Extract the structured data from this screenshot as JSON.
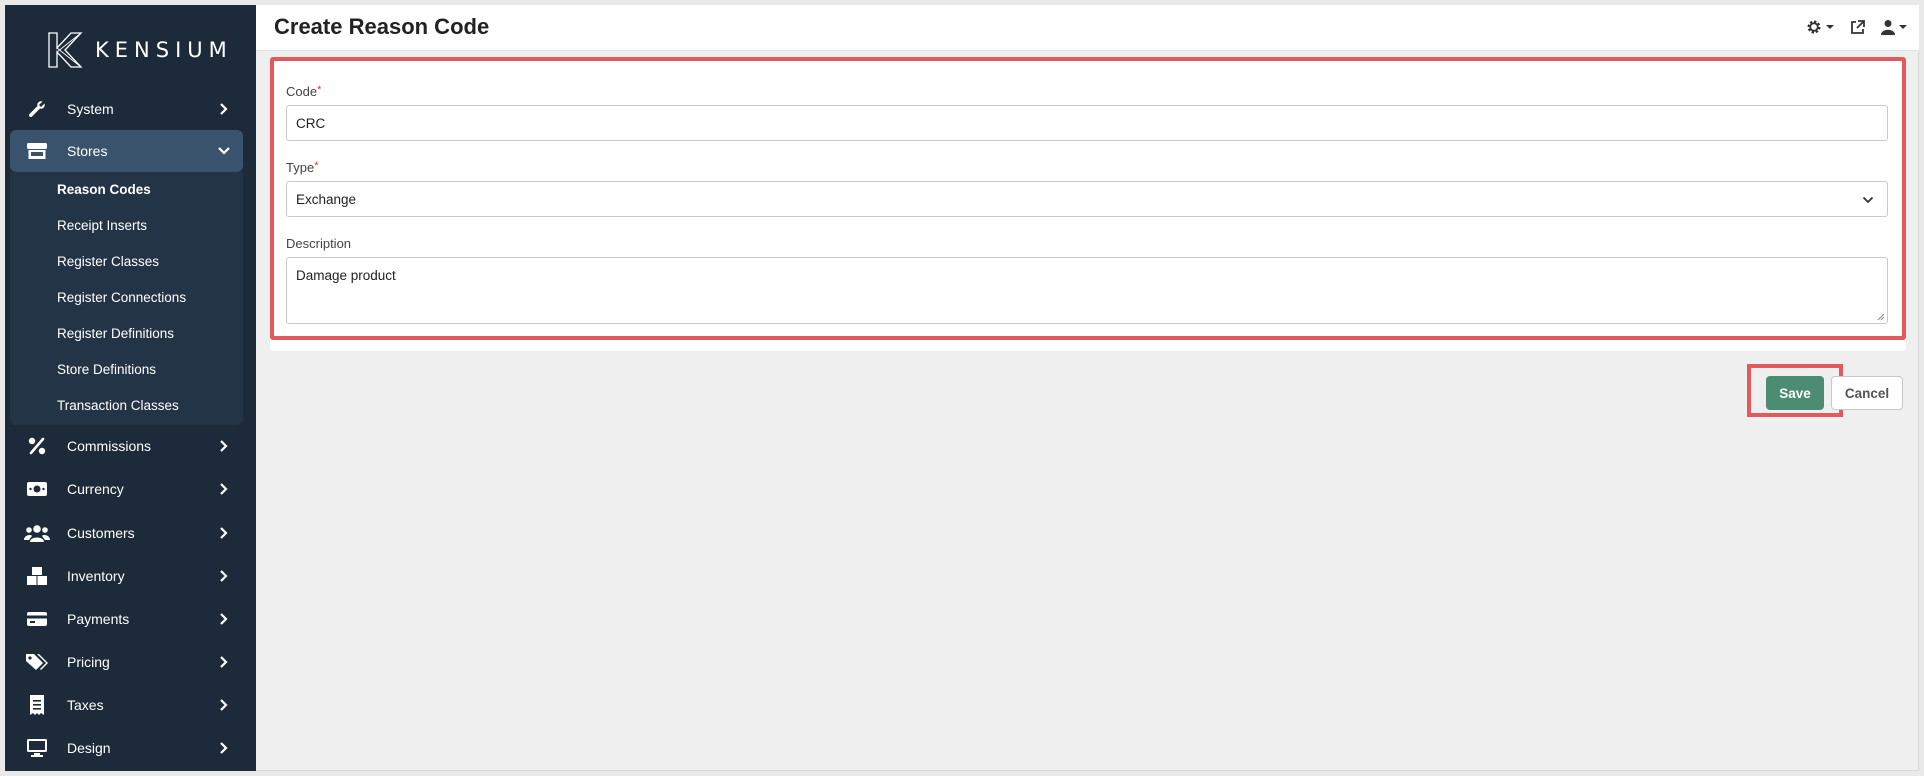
{
  "brand": {
    "name": "KENSIUM"
  },
  "header": {
    "title": "Create Reason Code"
  },
  "sidebar": {
    "items": [
      {
        "label": "System",
        "icon": "wrench-icon"
      },
      {
        "label": "Stores",
        "icon": "store-icon",
        "expanded": true
      },
      {
        "label": "Commissions",
        "icon": "percent-icon"
      },
      {
        "label": "Currency",
        "icon": "money-icon"
      },
      {
        "label": "Customers",
        "icon": "users-icon"
      },
      {
        "label": "Inventory",
        "icon": "boxes-icon"
      },
      {
        "label": "Payments",
        "icon": "credit-card-icon"
      },
      {
        "label": "Pricing",
        "icon": "tags-icon"
      },
      {
        "label": "Taxes",
        "icon": "receipt-icon"
      },
      {
        "label": "Design",
        "icon": "monitor-icon"
      }
    ],
    "stores_submenu": [
      "Reason Codes",
      "Receipt Inserts",
      "Register Classes",
      "Register Connections",
      "Register Definitions",
      "Store Definitions",
      "Transaction Classes"
    ]
  },
  "form": {
    "code": {
      "label": "Code",
      "required_mark": "*",
      "value": "CRC"
    },
    "type": {
      "label": "Type",
      "required_mark": "*",
      "value": "Exchange"
    },
    "description": {
      "label": "Description",
      "value": "Damage product"
    }
  },
  "actions": {
    "save_label": "Save",
    "cancel_label": "Cancel"
  },
  "colors": {
    "sidebar_bg": "#1c2a3a",
    "save_bg": "#4b8c73",
    "highlight": "#e25a5e"
  }
}
